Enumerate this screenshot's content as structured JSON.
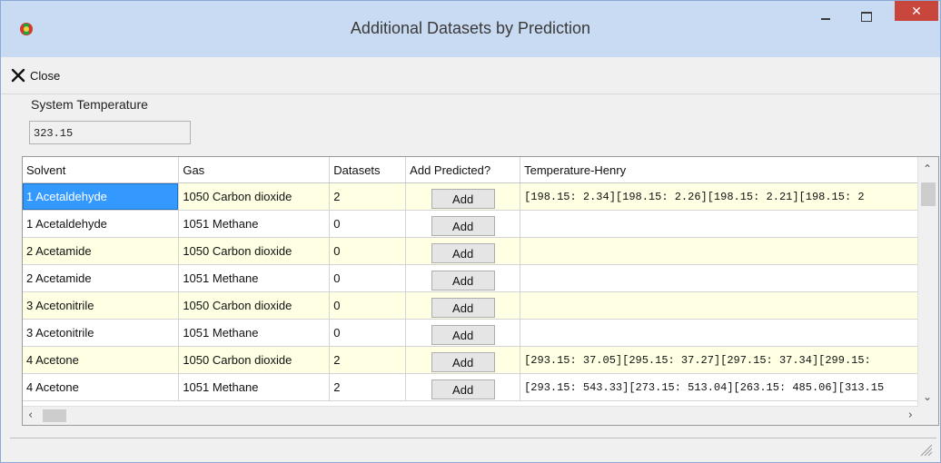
{
  "window": {
    "title": "Additional Datasets by Prediction",
    "close_glyph": "✕"
  },
  "toolbar": {
    "close_label": "Close",
    "close_icon": "x-icon"
  },
  "system": {
    "label": "System Temperature",
    "value": "323.15"
  },
  "grid": {
    "columns": [
      "Solvent",
      "Gas",
      "Datasets",
      "Add Predicted?",
      "Temperature-Henry"
    ],
    "add_label": "Add",
    "rows": [
      {
        "solvent": "1 Acetaldehyde",
        "gas": "1050 Carbon dioxide",
        "datasets": "2",
        "th": "[198.15:  2.34][198.15:  2.26][198.15:  2.21][198.15:  2"
      },
      {
        "solvent": "1 Acetaldehyde",
        "gas": "1051 Methane",
        "datasets": "0",
        "th": ""
      },
      {
        "solvent": "2 Acetamide",
        "gas": "1050 Carbon dioxide",
        "datasets": "0",
        "th": ""
      },
      {
        "solvent": "2 Acetamide",
        "gas": "1051 Methane",
        "datasets": "0",
        "th": ""
      },
      {
        "solvent": "3 Acetonitrile",
        "gas": "1050 Carbon dioxide",
        "datasets": "0",
        "th": ""
      },
      {
        "solvent": "3 Acetonitrile",
        "gas": "1051 Methane",
        "datasets": "0",
        "th": ""
      },
      {
        "solvent": "4 Acetone",
        "gas": "1050 Carbon dioxide",
        "datasets": "2",
        "th": "[293.15: 37.05][295.15: 37.27][297.15: 37.34][299.15:"
      },
      {
        "solvent": "4 Acetone",
        "gas": "1051 Methane",
        "datasets": "2",
        "th": "[293.15: 543.33][273.15: 513.04][263.15: 485.06][313.15"
      }
    ]
  },
  "colors": {
    "titlebar": "#c9daf3",
    "row_odd": "#ffffe3",
    "selection": "#3399ff",
    "close_button": "#c8463b"
  }
}
